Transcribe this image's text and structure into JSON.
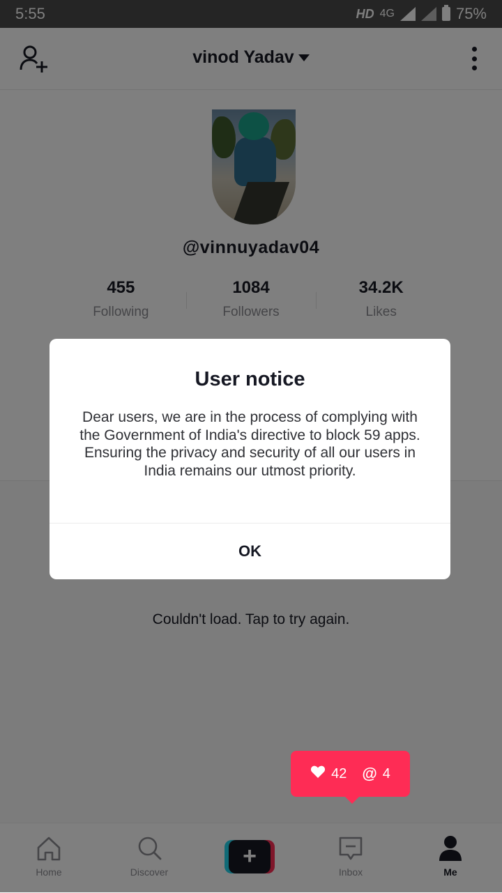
{
  "status_bar": {
    "time": "5:55",
    "hd": "HD",
    "network": "4G",
    "battery": "75%"
  },
  "header": {
    "title": "vinod Yadav"
  },
  "profile": {
    "handle": "@vinnuyadav04",
    "stats": [
      {
        "value": "455",
        "label": "Following"
      },
      {
        "value": "1084",
        "label": "Followers"
      },
      {
        "value": "34.2K",
        "label": "Likes"
      }
    ]
  },
  "content": {
    "error_text": "Couldn't load. Tap to try again."
  },
  "notification": {
    "likes": "42",
    "mentions": "4"
  },
  "dialog": {
    "title": "User notice",
    "message": "Dear users, we are in the process of complying with the Government of India's directive to block 59 apps. Ensuring the privacy and security of all our users in India remains our utmost priority.",
    "ok_label": "OK"
  },
  "nav": {
    "home": "Home",
    "discover": "Discover",
    "inbox": "Inbox",
    "me": "Me"
  },
  "colors": {
    "accent": "#fe2c55",
    "cyan": "#20d5ec",
    "text": "#161823"
  }
}
